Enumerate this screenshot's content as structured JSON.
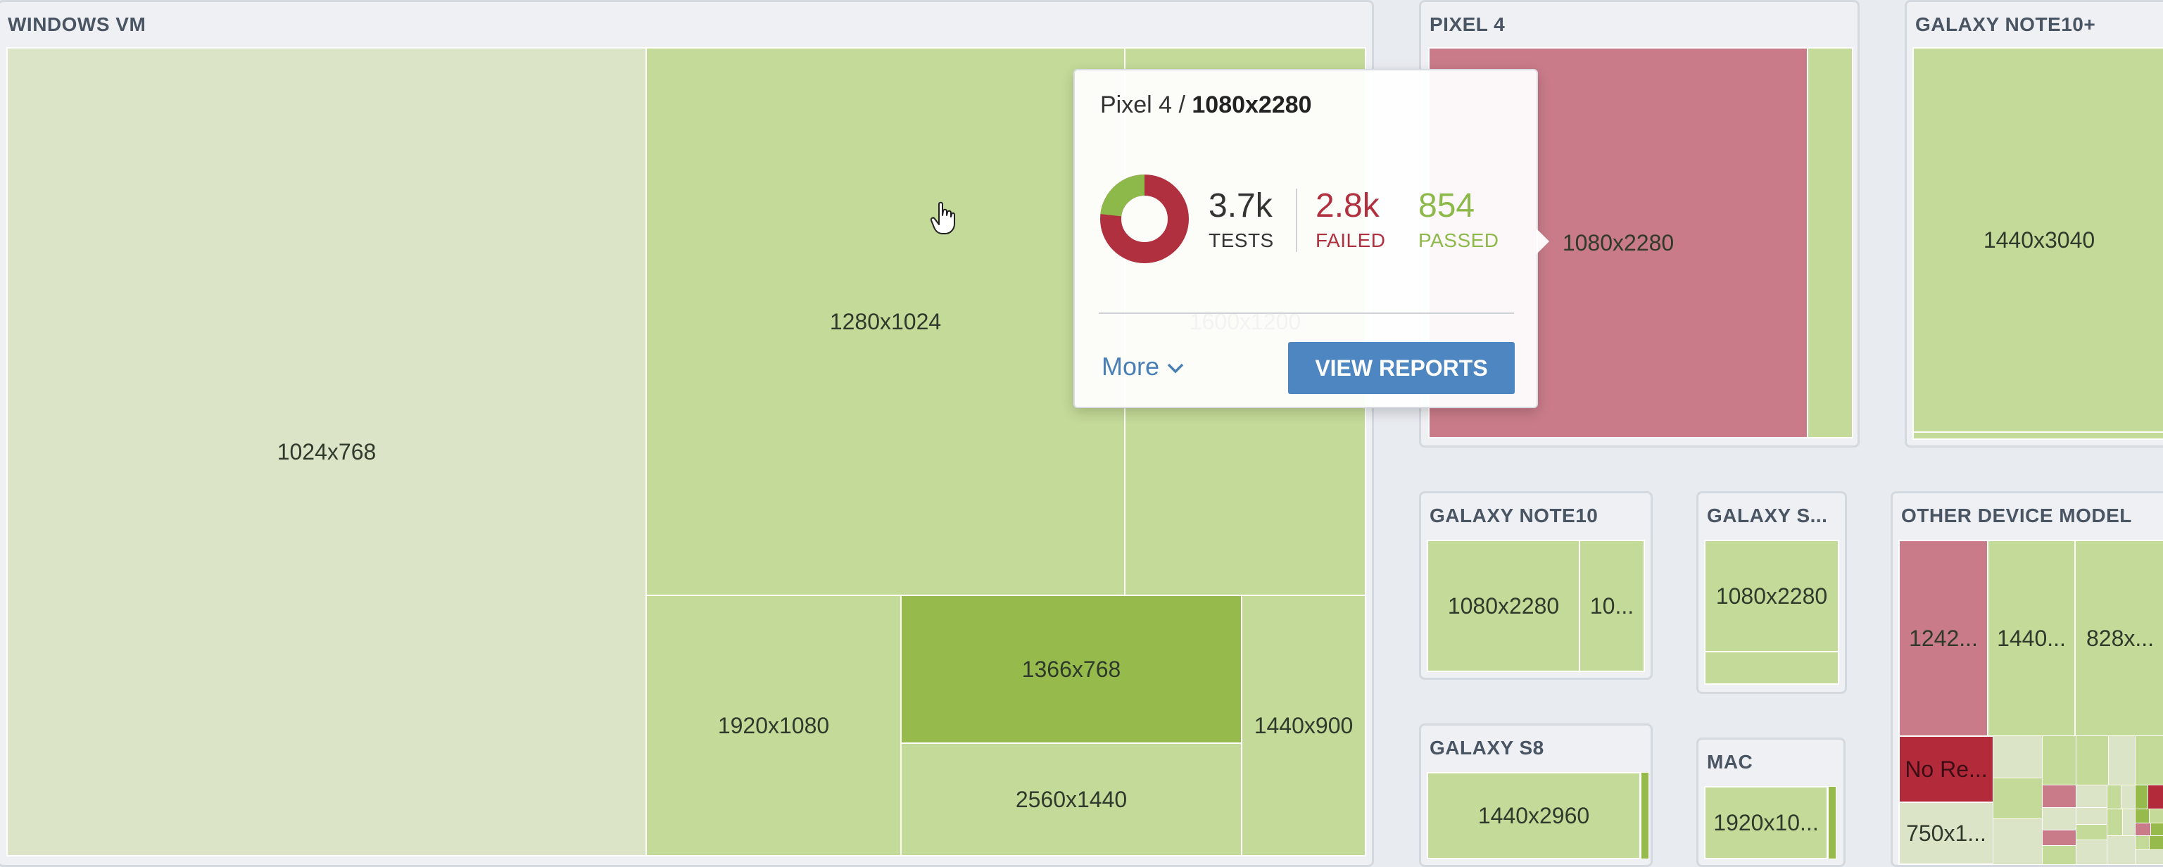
{
  "panels": {
    "windows_vm": {
      "title": "WINDOWS VM",
      "cells": {
        "c1024x768": "1024x768",
        "c1280x1024": "1280x1024",
        "c1600x1200": "1600x1200",
        "c1920x1080": "1920x1080",
        "c1366x768": "1366x768",
        "c2560x1440": "2560x1440",
        "c1440x900": "1440x900"
      }
    },
    "pixel4": {
      "title": "PIXEL 4",
      "cells": {
        "main": "1080x2280"
      }
    },
    "galaxy_note10_plus": {
      "title": "GALAXY NOTE10+",
      "cells": {
        "main": "1440x3040"
      }
    },
    "galaxy_note10": {
      "title": "GALAXY NOTE10",
      "cells": {
        "a": "1080x2280",
        "b": "10..."
      }
    },
    "galaxy_s": {
      "title": "GALAXY S...",
      "cells": {
        "a": "1080x2280"
      }
    },
    "other": {
      "title": "OTHER DEVICE MODEL",
      "cells": {
        "a": "1242...",
        "b": "1440...",
        "c": "828x...",
        "d": "No Re...",
        "e": "750x1..."
      }
    },
    "galaxy_s8": {
      "title": "GALAXY S8",
      "cells": {
        "a": "1440x2960"
      }
    },
    "mac": {
      "title": "MAC",
      "cells": {
        "a": "1920x10..."
      }
    }
  },
  "tooltip": {
    "device": "Pixel 4 / ",
    "resolution": "1080x2280",
    "tests_value": "3.7k",
    "tests_label": "TESTS",
    "failed_value": "2.8k",
    "failed_label": "FAILED",
    "passed_value": "854",
    "passed_label": "PASSED",
    "more_label": "More",
    "view_reports_label": "VIEW REPORTS"
  },
  "donut": {
    "failed": 2.8,
    "passed": 0.854
  },
  "colors": {
    "failed": "#b0303f",
    "passed": "#8db84a",
    "pale_green": "#dbe4c6",
    "light_green": "#c4da98",
    "mid_green": "#96bb4c",
    "light_red": "#c97b89",
    "dark_red": "#b32a3b",
    "link_blue": "#4a7fb5",
    "button_blue": "#4d86c0"
  },
  "icons": {
    "cursor": "hand-pointer-icon",
    "more": "chevron-down-icon"
  }
}
